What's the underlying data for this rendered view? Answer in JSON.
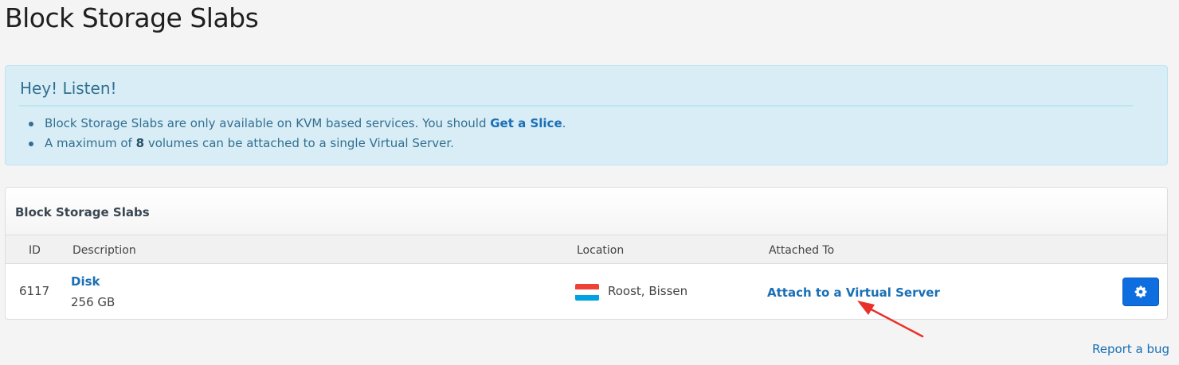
{
  "page": {
    "title": "Block Storage Slabs"
  },
  "alert": {
    "title": "Hey! Listen!",
    "items": [
      {
        "before": "Block Storage Slabs are only available on KVM based services. You should ",
        "link": "Get a Slice",
        "after": "."
      },
      {
        "before": "A maximum of ",
        "strong": "8",
        "after": " volumes can be attached to a single Virtual Server."
      }
    ]
  },
  "panel": {
    "title": "Block Storage Slabs",
    "columns": {
      "id": "ID",
      "description": "Description",
      "location": "Location",
      "attached_to": "Attached To"
    },
    "rows": [
      {
        "id": "6117",
        "name": "Disk",
        "size": "256 GB",
        "location": "Roost, Bissen",
        "flag_colors": [
          "#ef4135",
          "#ffffff",
          "#00a2e1"
        ],
        "attach_label": "Attach to a Virtual Server",
        "action_icon": "gear-icon"
      }
    ]
  },
  "footer": {
    "report_bug": "Report a bug"
  },
  "colors": {
    "link": "#1a6fb5",
    "alert_bg": "#d9edf7",
    "alert_text": "#31708f",
    "button": "#0e6ee0",
    "annotation_arrow": "#e8312a"
  }
}
